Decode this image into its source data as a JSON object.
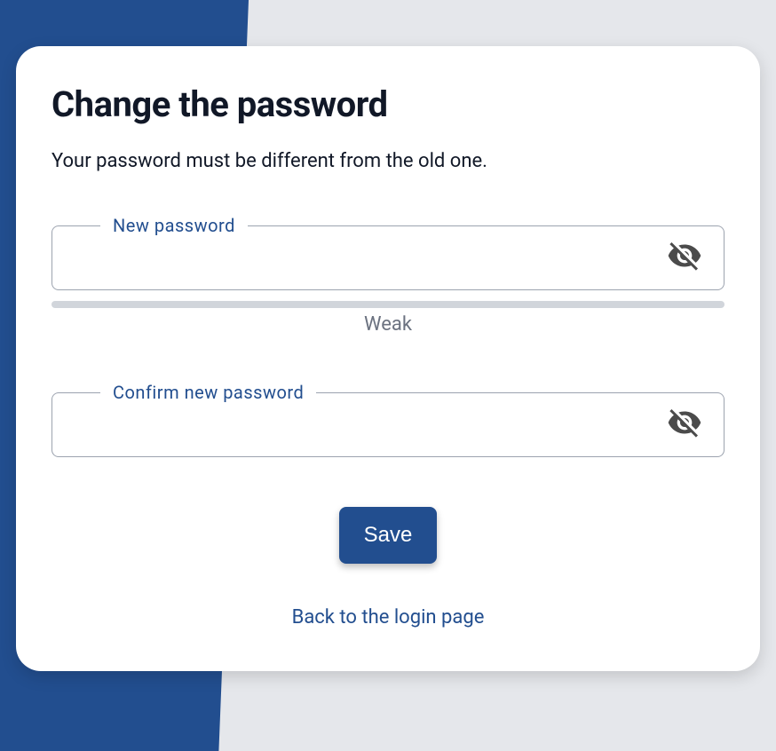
{
  "header": {
    "title": "Change the password",
    "subtitle": "Your password must be different from the old one."
  },
  "fields": {
    "new_password": {
      "label": "New password",
      "value": ""
    },
    "confirm_password": {
      "label": "Confirm new password",
      "value": ""
    }
  },
  "strength": {
    "label": "Weak",
    "percent": 0
  },
  "actions": {
    "save_label": "Save",
    "back_label": "Back to the login page"
  },
  "colors": {
    "brand": "#224e8f"
  }
}
